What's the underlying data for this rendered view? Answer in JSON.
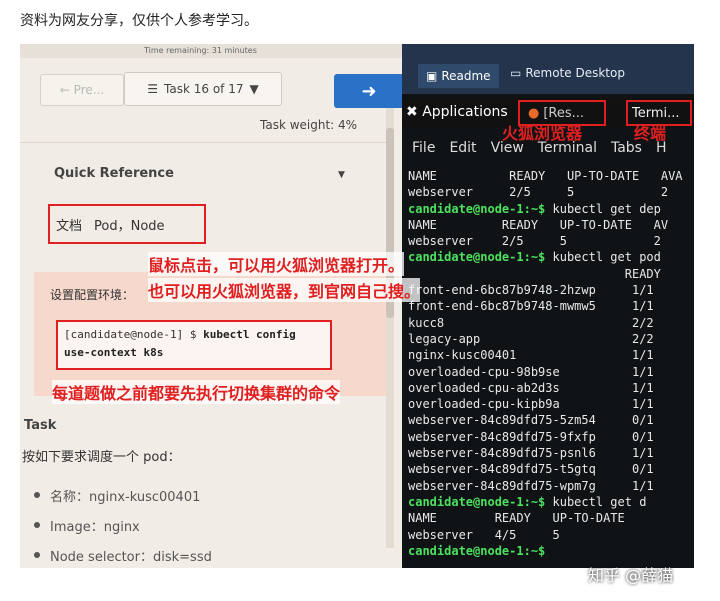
{
  "caption": "资料为网友分享，仅供个人参考学习。",
  "exam": {
    "time_remaining": "Time remaining: 31 minutes",
    "prev_label": "Pre...",
    "task_nav": "Task 16 of 17",
    "weight": "Task weight: 4%",
    "quick_reference": "Quick Reference",
    "docs_label": "文档",
    "docs_links": "Pod，Node",
    "env_label": "设置配置环境：",
    "code_prompt": "[candidate@node-1] $",
    "code_cmd1": "kubectl config",
    "code_cmd2": "use-context k8s",
    "task_heading": "Task",
    "task_desc": "按如下要求调度一个 pod：",
    "bullets": [
      "名称：nginx-kusc00401",
      "Image：nginx",
      "Node selector：disk=ssd"
    ]
  },
  "remote": {
    "tab_readme": "Readme",
    "tab_remote": "Remote Desktop",
    "applications": "Applications",
    "firefox_tab": "[Res...",
    "terminal_tab": "Termi...",
    "menu": [
      "File",
      "Edit",
      "View",
      "Terminal",
      "Tabs",
      "H"
    ]
  },
  "terminal_lines": [
    {
      "t": "NAME          READY   UP-TO-DATE   AVA"
    },
    {
      "t": "webserver     2/5     5            2"
    },
    {
      "p": "candidate@node-1:~$",
      "t": " kubectl get dep"
    },
    {
      "t": "NAME         READY   UP-TO-DATE   AV"
    },
    {
      "t": "webserver    2/5     5            2"
    },
    {
      "p": "candidate@node-1:~$",
      "t": " kubectl get pod"
    },
    {
      "t": "                              READY"
    },
    {
      "t": "front-end-6bc87b9748-2hzwp     1/1"
    },
    {
      "t": "front-end-6bc87b9748-mwmw5     1/1"
    },
    {
      "t": "kucc8                          2/2"
    },
    {
      "t": "legacy-app                     2/2"
    },
    {
      "t": "nginx-kusc00401                1/1"
    },
    {
      "t": "overloaded-cpu-98b9se          1/1"
    },
    {
      "t": "overloaded-cpu-ab2d3s          1/1"
    },
    {
      "t": "overloaded-cpu-kipb9a          1/1"
    },
    {
      "t": "webserver-84c89dfd75-5zm54     0/1"
    },
    {
      "t": "webserver-84c89dfd75-9fxfp     0/1"
    },
    {
      "t": "webserver-84c89dfd75-psnl6     1/1"
    },
    {
      "t": "webserver-84c89dfd75-t5gtq     0/1"
    },
    {
      "t": "webserver-84c89dfd75-wpm7g     1/1"
    },
    {
      "p": "candidate@node-1:~$",
      "t": " kubectl get d"
    },
    {
      "t": "NAME        READY   UP-TO-DATE"
    },
    {
      "t": "webserver   4/5     5"
    },
    {
      "p": "candidate@node-1:~$",
      "t": ""
    }
  ],
  "annotations": {
    "firefox": "火狐浏览器",
    "terminal": "终端",
    "click": "鼠标点击，可以用火狐浏览器打开。",
    "search": "也可以用火狐浏览器，到官网自己搜。",
    "context": "每道题做之前都要先执行切换集群的命令"
  },
  "watermark": "知乎 @薛猫",
  "colors": {
    "annotation": "#e02020",
    "prompt_green": "#4ce15e",
    "next_button": "#2a72c8"
  }
}
